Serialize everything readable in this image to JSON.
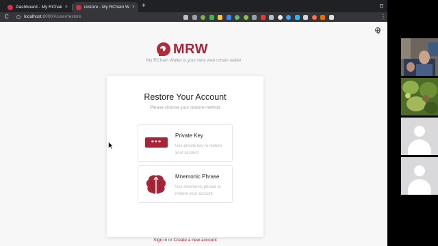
{
  "browser": {
    "tabs": [
      {
        "title": "Dashboard - My RChain Wallet",
        "active": false
      },
      {
        "title": "restore - My RChain Wallet",
        "active": true
      }
    ],
    "close_glyph": "×",
    "new_tab_glyph": "+",
    "reload_glyph": "C",
    "menu_glyph": "⋮",
    "url_host": "localhost",
    "url_rest": ":8000/#/user/restore",
    "extension_icons": [
      "key-icon",
      "star-icon",
      "android-icon",
      "shield-icon",
      "note-icon",
      "translate-icon",
      "leaf-icon",
      "circle-icon",
      "grid-icon",
      "fire-icon",
      "link-icon",
      "github-icon",
      "chrome-icon",
      "cast-icon",
      "z-icon",
      "dot-icon",
      "extension-icon",
      "extension-icon"
    ]
  },
  "page": {
    "logo_text": "MRW",
    "tagline": "My RChain Wallet is your best web rchain wallet",
    "card": {
      "title": "Restore Your Account",
      "subtitle": "Please choose your restore method",
      "options": [
        {
          "title": "Private Key",
          "description": "Use private key to restore your account",
          "icon": "password-icon",
          "icon_text": "***"
        },
        {
          "title": "Mnemonic Phrase",
          "description": "Use mnemonic phrase to restore your account",
          "icon": "brain-icon"
        }
      ],
      "signin_label": "Sign in",
      "or_label": "or",
      "create_label": "Create a new account"
    }
  },
  "colors": {
    "brand": "#a62538",
    "tab_bar": "#202124",
    "toolbar": "#35363a",
    "page_bg": "#f7f7f8"
  },
  "video_call": {
    "participants": [
      "webcam-tile",
      "webcam-tile",
      "avatar-placeholder",
      "avatar-placeholder"
    ]
  }
}
